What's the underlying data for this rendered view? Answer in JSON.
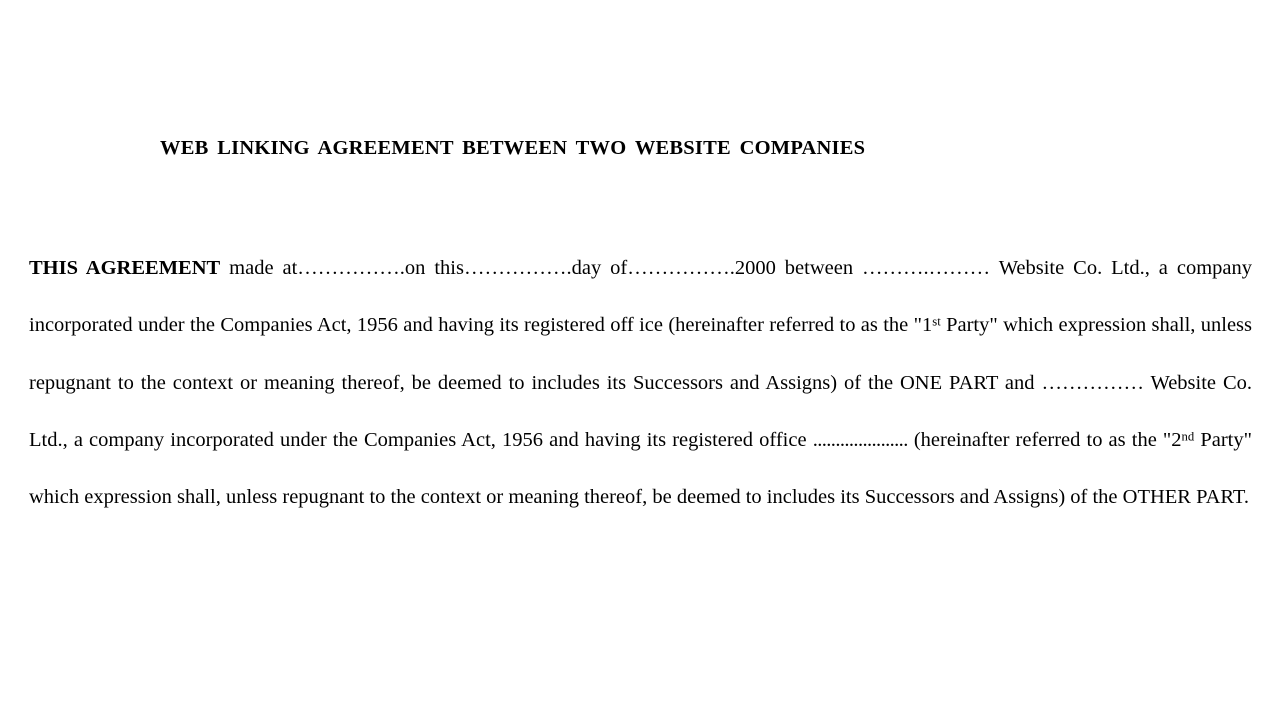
{
  "document": {
    "title": "WEB LINKING AGREEMENT BETWEEN TWO WEBSITE COMPANIES",
    "background_color": "#ffffff",
    "text_color": "#000000",
    "agreement": {
      "lead_bold": "THIS AGREEMENT",
      "seg_made_at": " made at",
      "blank_place": "…………….",
      "seg_on_this": "on this",
      "blank_date": "…………….",
      "seg_day_of": "day of",
      "blank_month": "…………….",
      "year": "2000",
      "seg_between": " between ",
      "blank_party1": "……….………",
      "seg_first_party_name": " Website Co. Ltd., a company incorporated under the Companies Act, 1956 and having its registered off ice (hereinafter referred to as the ",
      "quote_open_1": "\"1",
      "ordinal_1": "st",
      "party_label_1": " Party\"",
      "seg_after_party1": " which expression shall, unless repugnant to the context or meaning thereof, be deemed to includes its Successors and Assigns) of the ONE PART and ",
      "blank_party2": "……………",
      "seg_second_party_name": " Website Co. Ltd., a company incorporated under the Companies Act, 1956 and having its registered office ",
      "blank_office": ".....................",
      "seg_hereinafter_2": " (hereinafter referred to as the ",
      "quote_open_2": "\"2",
      "ordinal_2": "nd",
      "party_label_2": " Party\"",
      "seg_closing": " which expression shall, unless repugnant to the context or meaning thereof, be deemed to includes its Successors and Assigns) of the OTHER PART."
    }
  }
}
